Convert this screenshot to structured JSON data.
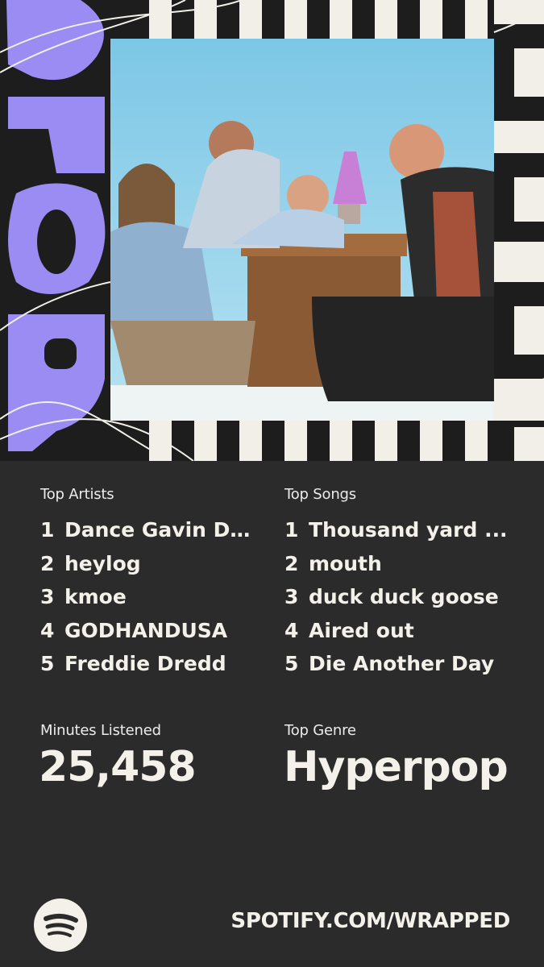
{
  "year_graphic": "2025",
  "colors": {
    "background": "#2b2b2b",
    "text": "#f4f1ea",
    "accent_purple": "#9b8cf3",
    "sky": "#8fd0e8"
  },
  "top_artists": {
    "label": "Top Artists",
    "items": [
      {
        "rank": "1",
        "name": "Dance Gavin Da..."
      },
      {
        "rank": "2",
        "name": "heylog"
      },
      {
        "rank": "3",
        "name": "kmoe"
      },
      {
        "rank": "4",
        "name": "GODHANDUSA"
      },
      {
        "rank": "5",
        "name": "Freddie Dredd"
      }
    ]
  },
  "top_songs": {
    "label": "Top Songs",
    "items": [
      {
        "rank": "1",
        "name": "Thousand yard ..."
      },
      {
        "rank": "2",
        "name": "mouth"
      },
      {
        "rank": "3",
        "name": "duck duck goose"
      },
      {
        "rank": "4",
        "name": "Aired out"
      },
      {
        "rank": "5",
        "name": "Die Another Day"
      }
    ]
  },
  "minutes": {
    "label": "Minutes Listened",
    "value": "25,458"
  },
  "genre": {
    "label": "Top Genre",
    "value": "Hyperpop"
  },
  "footer": {
    "logo_icon": "spotify-logo-icon",
    "url": "SPOTIFY.COM/WRAPPED"
  }
}
